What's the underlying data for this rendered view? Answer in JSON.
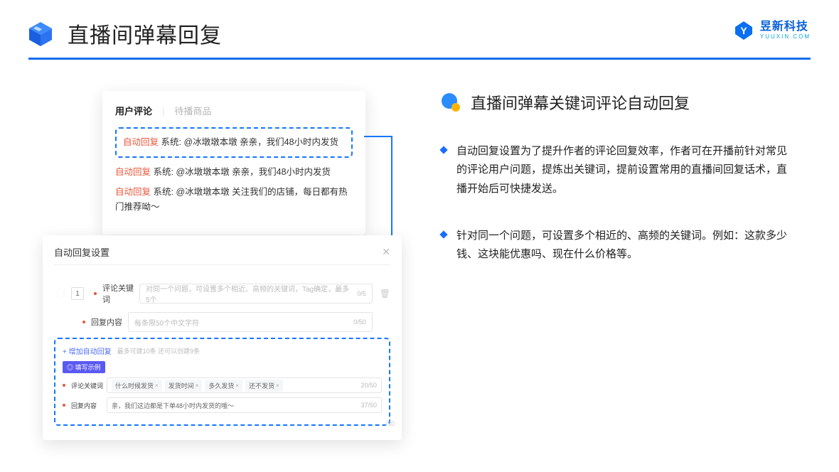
{
  "header": {
    "title": "直播间弹幕回复",
    "logo_cn": "昱新科技",
    "logo_en": "YUUXIN.COM"
  },
  "card1": {
    "tab_active": "用户评论",
    "tab_inactive": "待播商品",
    "tag": "自动回复",
    "system": "系统:",
    "highlight": "@冰墩墩本墩 亲亲，我们48小时内发货",
    "line2": "@冰墩墩本墩 亲亲，我们48小时内发货",
    "line3": "@冰墩墩本墩 关注我们的店铺，每日都有热门推荐呦～"
  },
  "card2": {
    "title": "自动回复设置",
    "idx": "1",
    "lbl_keyword": "评论关键词",
    "placeholder_kw": "对同一个问题，可设置多个相近、高频的关键词，Tag确定，最多5个",
    "count_kw": "0/5",
    "lbl_content": "回复内容",
    "placeholder_ct": "每条限50个中文字符",
    "count_ct": "0/50",
    "add_link": "+ 增加自动回复",
    "limit": "最多可建10条 还可以创建9条",
    "badge": "◎ 填写示例",
    "ex_lbl_kw": "评论关键词",
    "ex_chips": [
      "什么时候发货",
      "发货时间",
      "多久发货",
      "还不发货"
    ],
    "ex_count_kw": "20/50",
    "ex_lbl_ct": "回复内容",
    "ex_val_ct": "亲，我们这边都是下单48小时内发货的哦～",
    "ex_count_ct": "37/50",
    "ghost": "/50"
  },
  "right": {
    "title": "直播间弹幕关键词评论自动回复",
    "b1": "自动回复设置为了提升作者的评论回复效率，作者可在开播前针对常见的评论用户问题，提炼出关键词，提前设置常用的直播间回复话术，直播开始后可快捷发送。",
    "b2": "针对同一个问题，可设置多个相近的、高频的关键词。例如：这款多少钱、这块能优惠吗、现在什么价格等。"
  }
}
